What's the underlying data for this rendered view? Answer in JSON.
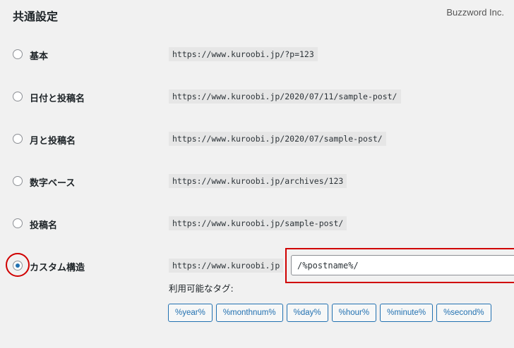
{
  "section_title": "共通設定",
  "watermark": "Buzzword Inc.",
  "options": [
    {
      "label": "基本",
      "example": "https://www.kuroobi.jp/?p=123",
      "checked": false
    },
    {
      "label": "日付と投稿名",
      "example": "https://www.kuroobi.jp/2020/07/11/sample-post/",
      "checked": false
    },
    {
      "label": "月と投稿名",
      "example": "https://www.kuroobi.jp/2020/07/sample-post/",
      "checked": false
    },
    {
      "label": "数字ベース",
      "example": "https://www.kuroobi.jp/archives/123",
      "checked": false
    },
    {
      "label": "投稿名",
      "example": "https://www.kuroobi.jp/sample-post/",
      "checked": false
    }
  ],
  "custom": {
    "label": "カスタム構造",
    "base_url": "https://www.kuroobi.jp",
    "value": "/%postname%/",
    "checked": true
  },
  "available_tags": {
    "label": "利用可能なタグ:",
    "tags": [
      "%year%",
      "%monthnum%",
      "%day%",
      "%hour%",
      "%minute%",
      "%second%"
    ]
  },
  "colors": {
    "accent": "#2271b1",
    "highlight": "#d00000"
  }
}
